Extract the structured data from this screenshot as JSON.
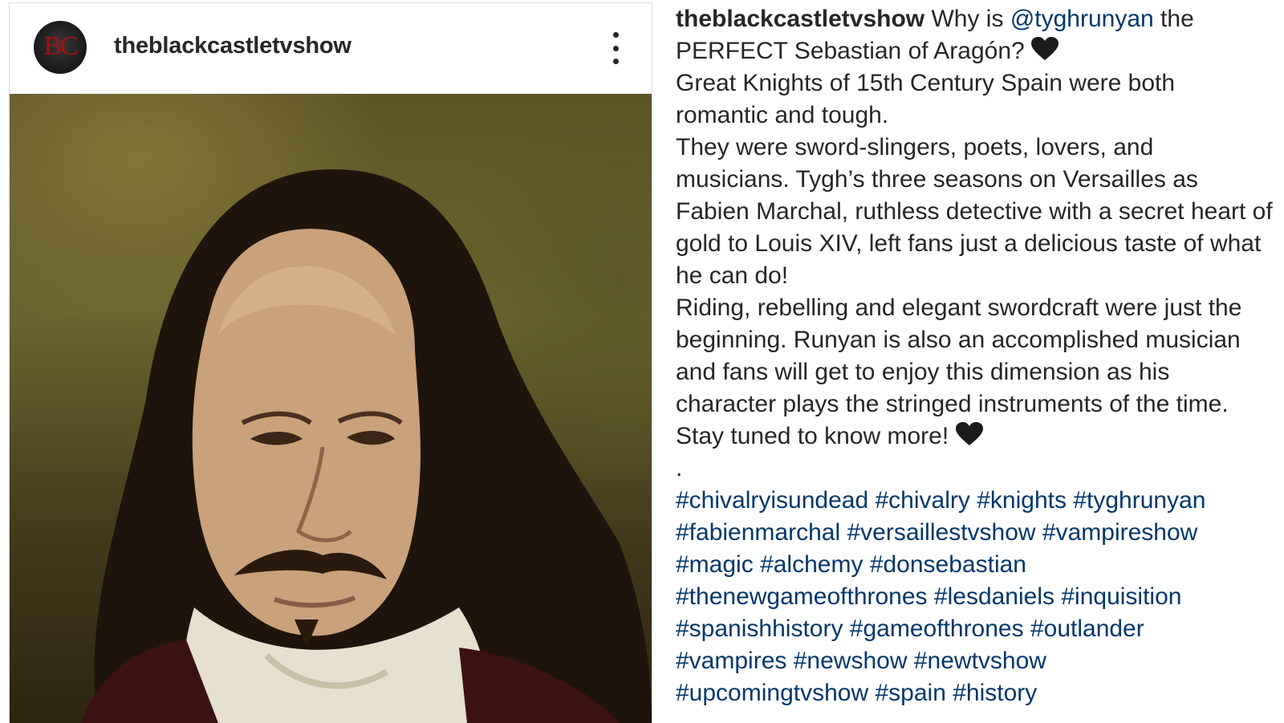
{
  "post": {
    "username": "theblackcastletvshow",
    "avatar_text": "BC",
    "more_icon": "more-vertical-icon"
  },
  "caption": {
    "username": "theblackcastletvshow",
    "intro_text": "Why is",
    "mention": "@tyghrunyan",
    "intro_rest": "the PERFECT Sebastian of Aragón?",
    "lines": [
      "Great Knights of 15th Century Spain were both romantic and tough.",
      "They were sword-slingers, poets, lovers, and musicians. Tygh’s three seasons on Versailles as Fabien Marchal, ruthless detective with a secret heart of gold to Louis XIV, left fans just a delicious taste of what he can do!",
      "Riding, rebelling and elegant swordcraft were just the beginning. Runyan is also an accomplished musician and fans will get to enjoy this dimension as his character plays the stringed instruments of the time."
    ],
    "closing": "Stay tuned to know more!",
    "separator": ".",
    "hashtags": [
      "#chivalryisundead",
      "#chivalry",
      "#knights",
      "#tyghrunyan",
      "#fabienmarchal",
      "#versaillestvshow",
      "#vampireshow",
      "#magic",
      "#alchemy",
      "#donsebastian",
      "#thenewgameofthrones",
      "#lesdaniels",
      "#inquisition",
      "#spanishhistory",
      "#gameofthrones",
      "#outlander",
      "#vampires",
      "#newshow",
      "#newtvshow",
      "#upcomingtvshow",
      "#spain",
      "#history"
    ],
    "heart_icon": "black-heart-icon",
    "link_color": "#00376b"
  }
}
